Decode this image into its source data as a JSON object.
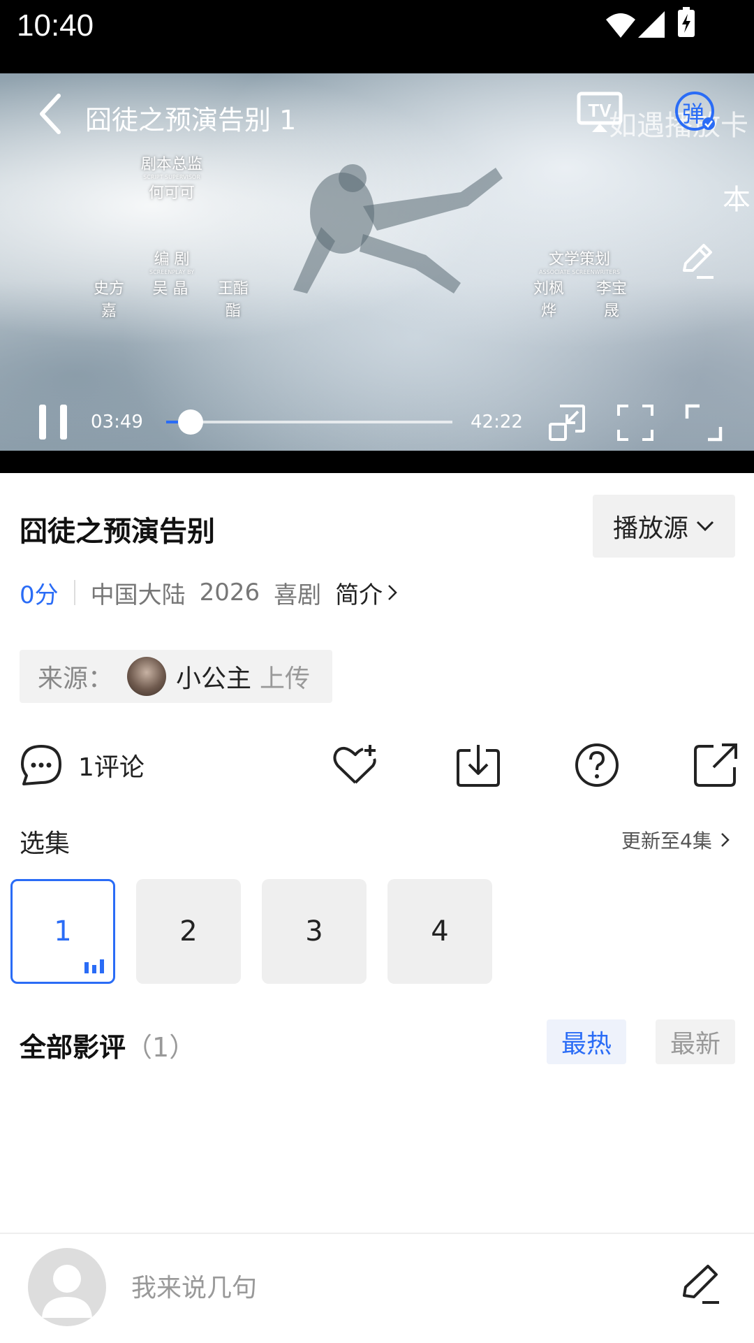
{
  "status_bar": {
    "time": "10:40"
  },
  "player": {
    "title": "囧徒之预演告别 1",
    "current_time": "03:49",
    "total_time": "42:22",
    "progress": 0.09,
    "overlay_text_1": "如遇播放卡",
    "overlay_text_2": "本",
    "danmu_label": "弹",
    "credits": [
      {
        "title": "剧本总监",
        "subtitle": "SCRIPT SUPERVISOR",
        "names": [
          "何可可"
        ]
      },
      {
        "title": "编 剧",
        "subtitle": "SCREENPLAY BY",
        "names": [
          "史方嘉",
          "吴 晶",
          "王酯酯"
        ]
      },
      {
        "title": "文学策划",
        "subtitle": "ASSOCIATE SCREENWRITERS",
        "names": [
          "刘枫烨",
          "李宝晟"
        ]
      }
    ]
  },
  "show": {
    "title": "囧徒之预演告别",
    "source_select": "播放源",
    "score": "0分",
    "region": "中国大陆",
    "year": "2026",
    "genre": "喜剧",
    "intro_link": "简介"
  },
  "uploader": {
    "label": "来源：",
    "name": "小公主",
    "suffix": "上传"
  },
  "actions": {
    "comment_label": "1评论"
  },
  "episodes": {
    "label": "选集",
    "update": "更新至4集",
    "items": [
      "1",
      "2",
      "3",
      "4"
    ],
    "selected": "1"
  },
  "reviews": {
    "title": "全部影评",
    "count": "（1）",
    "sort_hot": "最热",
    "sort_new": "最新"
  },
  "bottom": {
    "placeholder": "我来说几句"
  },
  "colors": {
    "accent": "#2a6cf6",
    "status_bar": "#000000"
  }
}
